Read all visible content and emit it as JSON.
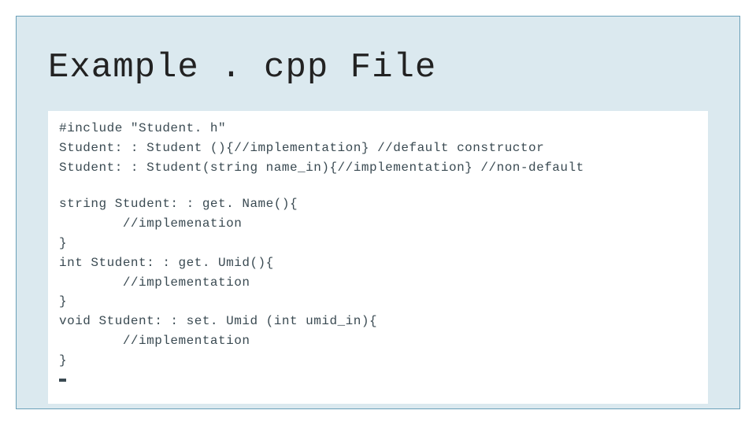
{
  "slide": {
    "title": "Example . cpp File"
  },
  "code": {
    "l1": "#include \"Student. h\"",
    "l2": "Student: : Student (){//implementation} //default constructor",
    "l3": "Student: : Student(string name_in){//implementation} //non-default",
    "l4": "string Student: : get. Name(){",
    "l5": "        //implemenation",
    "l6": "}",
    "l7": "int Student: : get. Umid(){",
    "l8": "        //implementation",
    "l9": "}",
    "l10": "void Student: : set. Umid (int umid_in){",
    "l11": "        //implementation",
    "l12": "}"
  }
}
